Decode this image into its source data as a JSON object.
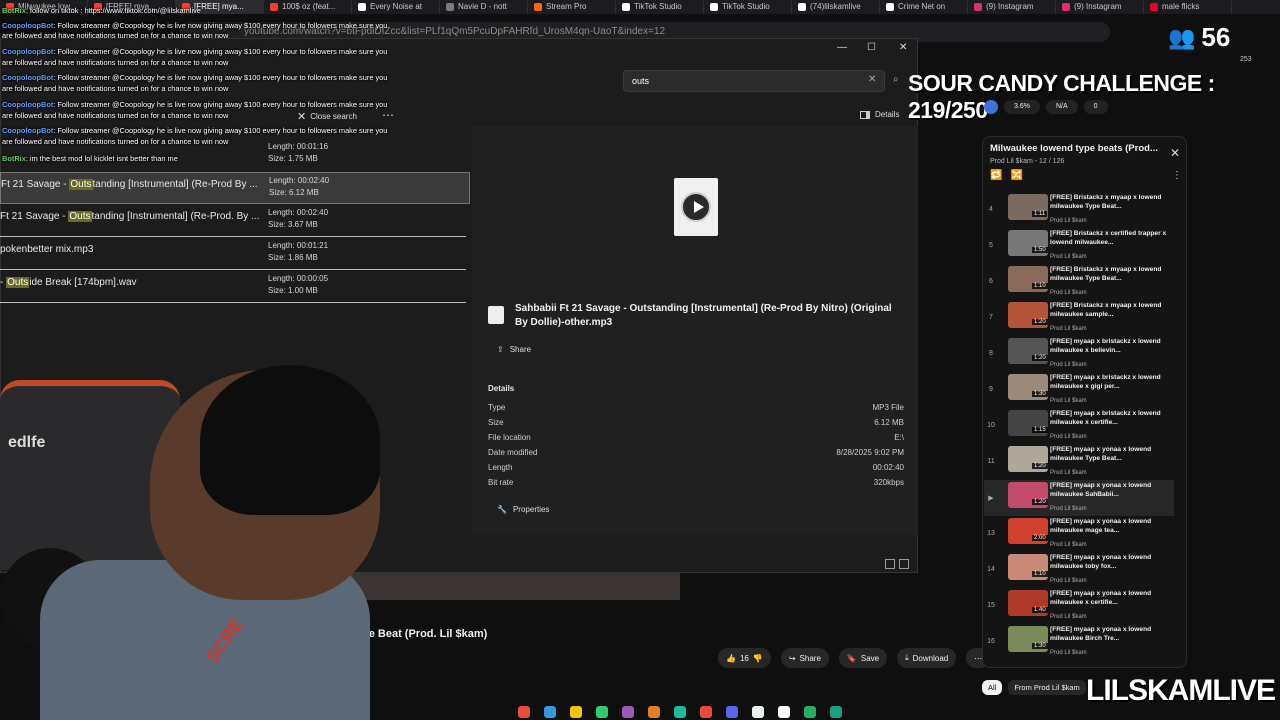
{
  "browser": {
    "tabs": [
      {
        "label": "Milwaukee low...",
        "color": "#ff3b30"
      },
      {
        "label": "[FREE] mya...",
        "color": "#ff3b30"
      },
      {
        "label": "[FREE] mya...",
        "color": "#ff3b30",
        "active": true
      },
      {
        "label": "100$ oz (feat...",
        "color": "#ff3b30"
      },
      {
        "label": "Every Noise at",
        "color": "#ffffff"
      },
      {
        "label": "Navie D - nott",
        "color": "#7b7b7b"
      },
      {
        "label": "Stream Pro",
        "color": "#ff6a00"
      },
      {
        "label": "TikTok Studio",
        "color": "#ffffff"
      },
      {
        "label": "TikTok Studio",
        "color": "#ffffff"
      },
      {
        "label": "(74)lilskamlive",
        "color": "#ffffff"
      },
      {
        "label": "Crime Net on",
        "color": "#ffffff"
      },
      {
        "label": "(9) Instagram",
        "color": "#e1306c"
      },
      {
        "label": "(9) Instagram",
        "color": "#e1306c"
      },
      {
        "label": "male flicks",
        "color": "#e60023"
      }
    ],
    "url": "youtube.com/watch?v=btFpdlDfZcc&list=PLf1qQm5PcuDpFAHRfd_UrosM4qn-UaoT&index=12"
  },
  "chat": [
    {
      "user": "BotRix",
      "text": ": follow on tiktok : https://www.tiktok.com/@lilskamlive",
      "color": "green"
    },
    {
      "user": "CoopoloopBot",
      "text": ": Follow streamer @Coopology he is live now giving away $100 every hour to followers make sure you",
      "color": "blue"
    },
    {
      "user": "",
      "text": "are followed and have notifications turned on for a chance to win now",
      "color": ""
    },
    {
      "user": "CoopoloopBot",
      "text": ": Follow streamer @Coopology he is live now giving away $100 every hour to followers make sure you",
      "color": "blue"
    },
    {
      "user": "",
      "text": "are followed and have notifications turned on for a chance to win now",
      "color": ""
    },
    {
      "user": "CoopoloopBot",
      "text": ": Follow streamer @Coopology he is live now giving away $100 every hour to followers make sure you",
      "color": "blue"
    },
    {
      "user": "",
      "text": "are followed and have notifications turned on for a chance to win now",
      "color": ""
    },
    {
      "user": "CoopoloopBot",
      "text": ": Follow streamer @Coopology he is live now giving away $100 every hour to followers make sure you",
      "color": "blue"
    },
    {
      "user": "",
      "text": "are followed and have notifications turned on for a chance to win now",
      "color": ""
    },
    {
      "user": "CoopoloopBot",
      "text": ": Follow streamer @Coopology he is live now giving away $100 every hour to followers make sure you",
      "color": "blue"
    },
    {
      "user": "",
      "text": "are followed and have notifications turned on for a chance to win now",
      "color": ""
    },
    {
      "user": "BotRix",
      "text": ": im the best mod lol kicklet isnt better than me",
      "color": "green"
    }
  ],
  "explorer": {
    "search_value": "outs",
    "close_search": "Close search",
    "details_label": "Details",
    "results": [
      {
        "pre": "Ft 21 Savage - ",
        "hl": "Outs",
        "post": "tanding [Instrumental] (Re-Prod By ...",
        "length": "Length: 00:02:40",
        "size": "Size: 6.12 MB",
        "selected": true
      },
      {
        "pre": "Ft 21 Savage - ",
        "hl": "Outs",
        "post": "tanding [Instrumental] (Re-Prod. By ...",
        "length": "Length: 00:02:40",
        "size": "Size: 3.67 MB",
        "selected": false
      },
      {
        "pre": "pokenbetter mix.mp3",
        "hl": "",
        "post": "",
        "length": "Length: 00:01:21",
        "size": "Size: 1.86 MB",
        "selected": false
      },
      {
        "pre": "- ",
        "hl": "Outs",
        "post": "ide Break [174bpm].wav",
        "length": "Length: 00:00:05",
        "size": "Size: 1.00 MB",
        "selected": false
      }
    ],
    "prev_result": {
      "length": "Length: 00:01:16",
      "size": "Size: 1.75 MB"
    },
    "preview": {
      "title": "Sahbabii Ft 21 Savage - Outstanding [Instrumental] (Re-Prod By Nitro) (Original By Dollie)-other.mp3",
      "share_label": "Share",
      "details_heading": "Details",
      "rows": [
        {
          "k": "Type",
          "v": "MP3 File"
        },
        {
          "k": "Size",
          "v": "6.12 MB"
        },
        {
          "k": "File location",
          "v": "E:\\"
        },
        {
          "k": "Date modified",
          "v": "8/28/2025 9:02 PM"
        },
        {
          "k": "Length",
          "v": "00:02:40"
        },
        {
          "k": "Bit rate",
          "v": "320kbps"
        }
      ],
      "properties_label": "Properties"
    }
  },
  "youtube": {
    "video_title": "Type Beat (Prod. Lil $kam)",
    "likes": "16",
    "share": "Share",
    "save": "Save",
    "download": "Download",
    "filter_all": "All",
    "filter_from": "From Prod Lil $kam"
  },
  "overlay": {
    "viewers": "56",
    "challenge": "SOUR CANDY CHALLENGE : 219/250",
    "watermark": "LILSKAMLIVE",
    "ext_chip1": "3.6%",
    "ext_chip2": "N/A",
    "ext_chip3": "0",
    "counts": "253"
  },
  "playlist": {
    "title": "Milwaukee lowend type beats (Prod...",
    "subtitle": "Prod Lil $kam - 12 / 126",
    "items": [
      {
        "idx": "4",
        "dur": "1:11",
        "title": "[FREE] Bristackz x myaap x lowend milwaukee Type Beat...",
        "channel": "Prod Lil $kam",
        "tc": "#7a6a60"
      },
      {
        "idx": "5",
        "dur": "1:50",
        "title": "[FREE] Bristackz x certified trapper x lowend milwaukee...",
        "channel": "Prod Lil $kam",
        "tc": "#777777"
      },
      {
        "idx": "6",
        "dur": "1:10",
        "title": "[FREE] Bristackz x myaap x lowend milwaukee Type Beat...",
        "channel": "Prod Lil $kam",
        "tc": "#8a6b5a"
      },
      {
        "idx": "7",
        "dur": "1:20",
        "title": "[FREE] Bristackz x myaap x lowend milwaukee sample...",
        "channel": "Prod Lil $kam",
        "tc": "#b4553a"
      },
      {
        "idx": "8",
        "dur": "1:20",
        "title": "[FREE] myaap x bristackz x lowend milwaukee x believin...",
        "channel": "Prod Lil $kam",
        "tc": "#555555"
      },
      {
        "idx": "9",
        "dur": "1:30",
        "title": "[FREE] myaap x bristackz x lowend milwaukee x gigi per...",
        "channel": "Prod Lil $kam",
        "tc": "#9b8a7a"
      },
      {
        "idx": "10",
        "dur": "1:15",
        "title": "[FREE] myaap x bristackz x lowend milwaukee x certifie...",
        "channel": "Prod Lil $kam",
        "tc": "#444444"
      },
      {
        "idx": "11",
        "dur": "1:20",
        "title": "[FREE] myaap x yonaa x lowend milwaukee Type Beat...",
        "channel": "Prod Lil $kam",
        "tc": "#b0a69a"
      },
      {
        "idx": "▶",
        "dur": "1:20",
        "title": "[FREE] myaap x yonaa x lowend milwaukee SahBabii...",
        "channel": "Prod Lil $kam",
        "tc": "#c24a6a",
        "current": true
      },
      {
        "idx": "13",
        "dur": "2:00",
        "title": "[FREE] myaap x yonaa x lowend milwaukee mage tea...",
        "channel": "Prod Lil $kam",
        "tc": "#d0402c"
      },
      {
        "idx": "14",
        "dur": "1:10",
        "title": "[FREE] myaap x yonaa x lowend milwaukee toby fox...",
        "channel": "Prod Lil $kam",
        "tc": "#c98a7a"
      },
      {
        "idx": "15",
        "dur": "1:40",
        "title": "[FREE] myaap x yonaa x lowend milwaukee x certifie...",
        "channel": "Prod Lil $kam",
        "tc": "#b03a2a"
      },
      {
        "idx": "16",
        "dur": "1:30",
        "title": "[FREE] myaap x yonaa x lowend milwaukee Birch Tre...",
        "channel": "Prod Lil $kam",
        "tc": "#7a8a5a"
      }
    ]
  },
  "webcam": {
    "chair_logo": "edlfe",
    "hoodie_text": "SCRE"
  },
  "taskbar_colors": [
    "#e74c3c",
    "#3498db",
    "#f1c40f",
    "#2ecc71",
    "#9b59b6",
    "#e67e22",
    "#1abc9c",
    "#e74c3c",
    "#5865f2",
    "#ecf0f1",
    "#ffffff",
    "#27ae60",
    "#16a085"
  ]
}
